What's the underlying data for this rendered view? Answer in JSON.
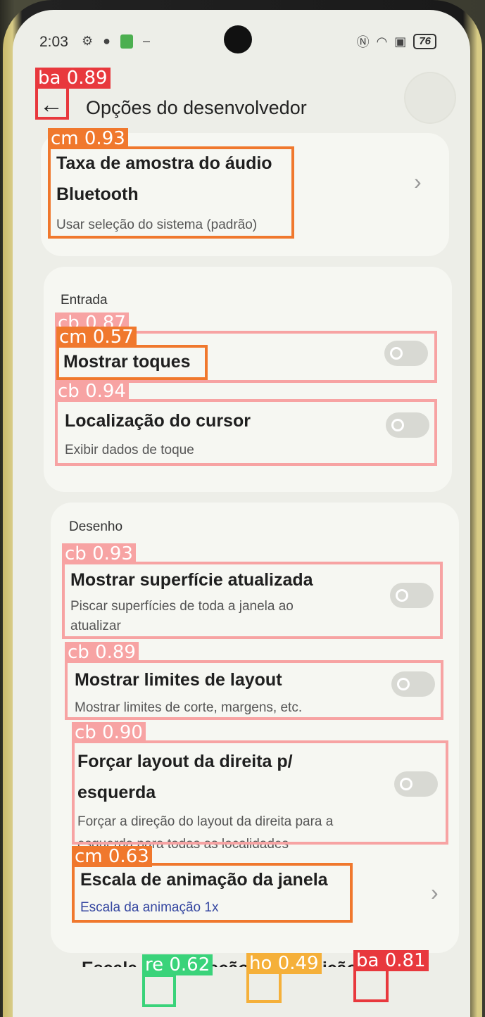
{
  "status_bar": {
    "time": "2:03",
    "battery": "76",
    "icons": [
      "gear-icon",
      "notification-icon",
      "app-icon",
      "nfc-icon",
      "wifi-icon",
      "no-sim-icon",
      "battery-icon"
    ]
  },
  "header": {
    "title": "Opções do desenvolvedor",
    "back_icon": "←"
  },
  "items": {
    "bluetooth_sample": {
      "title_line1": "Taxa de amostra do áudio",
      "title_line2": "Bluetooth",
      "subtitle": "Usar seleção do sistema (padrão)"
    },
    "input_section": "Entrada",
    "show_touches": {
      "title": "Mostrar toques",
      "enabled": false
    },
    "pointer_location": {
      "title": "Localização do cursor",
      "subtitle": "Exibir dados de toque",
      "enabled": false
    },
    "drawing_section": "Desenho",
    "show_surface_updates": {
      "title": "Mostrar superfície atualizada",
      "subtitle_line1": "Piscar superfícies de toda a janela ao",
      "subtitle_line2": "atualizar",
      "enabled": false
    },
    "show_layout_bounds": {
      "title": "Mostrar limites de layout",
      "subtitle": "Mostrar limites de corte, margens, etc.",
      "enabled": false
    },
    "force_rtl": {
      "title_line1": "Forçar layout da direita p/",
      "title_line2": "esquerda",
      "subtitle_line1": "Forçar a direção do layout da direita para a",
      "subtitle_line2": "esquerda para todas as localidades",
      "enabled": false
    },
    "window_animation": {
      "title": "Escala de animação da janela",
      "subtitle": "Escala da animação 1x"
    },
    "transition_animation_partial": "Escala de animação de transição"
  },
  "detections": [
    {
      "label": "ba 0.89",
      "cls": "ba"
    },
    {
      "label": "cm 0.93",
      "cls": "cm"
    },
    {
      "label": "cb 0.87",
      "cls": "cb"
    },
    {
      "label": "cm 0.57",
      "cls": "cm"
    },
    {
      "label": "cb 0.94",
      "cls": "cb"
    },
    {
      "label": "cb 0.93",
      "cls": "cb"
    },
    {
      "label": "cb 0.89",
      "cls": "cb"
    },
    {
      "label": "cb 0.90",
      "cls": "cb"
    },
    {
      "label": "cm 0.63",
      "cls": "cm"
    },
    {
      "label": "re 0.62",
      "cls": "re"
    },
    {
      "label": "ho 0.49",
      "cls": "ho"
    },
    {
      "label": "ba 0.81",
      "cls": "ba"
    }
  ],
  "colors": {
    "ba": "#e8383d",
    "cm": "#f0782d",
    "cb": "#f7a3a3",
    "re": "#3ad37a",
    "ho": "#f5b03a"
  }
}
